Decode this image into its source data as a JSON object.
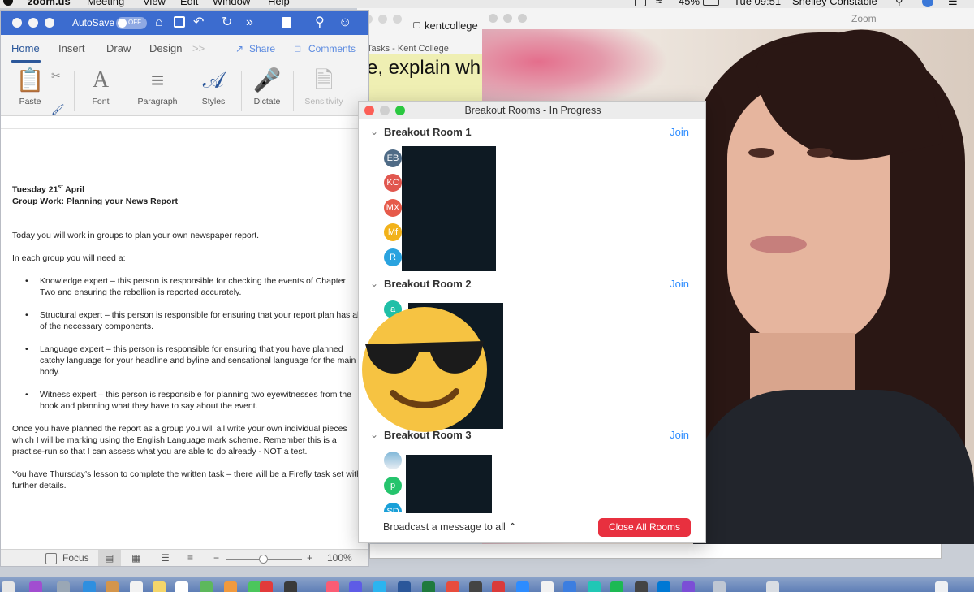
{
  "menubar": {
    "items": [
      "zoom.us",
      "Meeting",
      "View",
      "Edit",
      "Window",
      "Help"
    ],
    "battery": "45%",
    "clock": "Tue 09:51",
    "user": "Shelley Constable"
  },
  "browser": {
    "url": "kentcollege",
    "tab_title": "Tasks - Kent College",
    "content_text": "e, explain wh"
  },
  "zoom_window": {
    "title": "Zoom"
  },
  "word": {
    "autosave_label": "AutoSave",
    "autosave_state": "OFF",
    "tabs": [
      "Home",
      "Insert",
      "Draw",
      "Design"
    ],
    "more_tabs": ">>",
    "share_label": "Share",
    "comments_label": "Comments",
    "ribbon_groups": [
      "Paste",
      "Font",
      "Paragraph",
      "Styles",
      "Dictate",
      "Sensitivity"
    ],
    "status": {
      "focus_label": "Focus",
      "zoom_percent": "100%"
    },
    "document": {
      "date_prefix": "Tuesday 21",
      "date_sup": "st",
      "date_suffix": " April",
      "subtitle": "Group Work: Planning your News Report",
      "p1": "Today you will work in groups to plan your own newspaper report.",
      "p2": "In each group you will need a:",
      "bullets": [
        "Knowledge expert – this person is responsible for checking the events of Chapter Two and ensuring the rebellion is reported accurately.",
        "Structural expert – this person is responsible for ensuring that your report plan has all of the necessary components.",
        "Language expert – this person is responsible for ensuring that you have planned catchy language for your headline and byline and sensational language for the main body.",
        "Witness expert – this person is responsible for planning two eyewitnesses from the book and planning what they have to say about the event."
      ],
      "p3": "Once you have planned the report as a group you will all write your own individual pieces which I will be marking using the English Language mark scheme. Remember this is a practise-run so that I can assess what you are able to do already - NOT a test.",
      "p4": "You have Thursday’s lesson to complete the written task – there will be a Firefly task set with further details."
    }
  },
  "breakout": {
    "title": "Breakout Rooms - In Progress",
    "join_label": "Join",
    "rooms": [
      {
        "name": "Breakout Room 1",
        "participants": [
          "EB",
          "KC",
          "MX",
          "Mf",
          "R"
        ]
      },
      {
        "name": "Breakout Room 2",
        "participants": [
          "a"
        ]
      },
      {
        "name": "Breakout Room 3",
        "participants": [
          "",
          "p",
          "SD"
        ]
      }
    ],
    "broadcast_label": "Broadcast a message to all",
    "close_all_label": "Close All Rooms",
    "colors": {
      "join": "#2d8cff",
      "close_button": "#e8303f",
      "avatars": [
        "#4f6b86",
        "#e1574f",
        "#e65a4a",
        "#f2b21a",
        "#2aa3df",
        "#20bfa7",
        "#7fb7d8",
        "#25c46d",
        "#1aa0d8"
      ]
    }
  },
  "colors": {
    "word_blue": "#3c6ccf",
    "word_accent": "#2b579a"
  }
}
